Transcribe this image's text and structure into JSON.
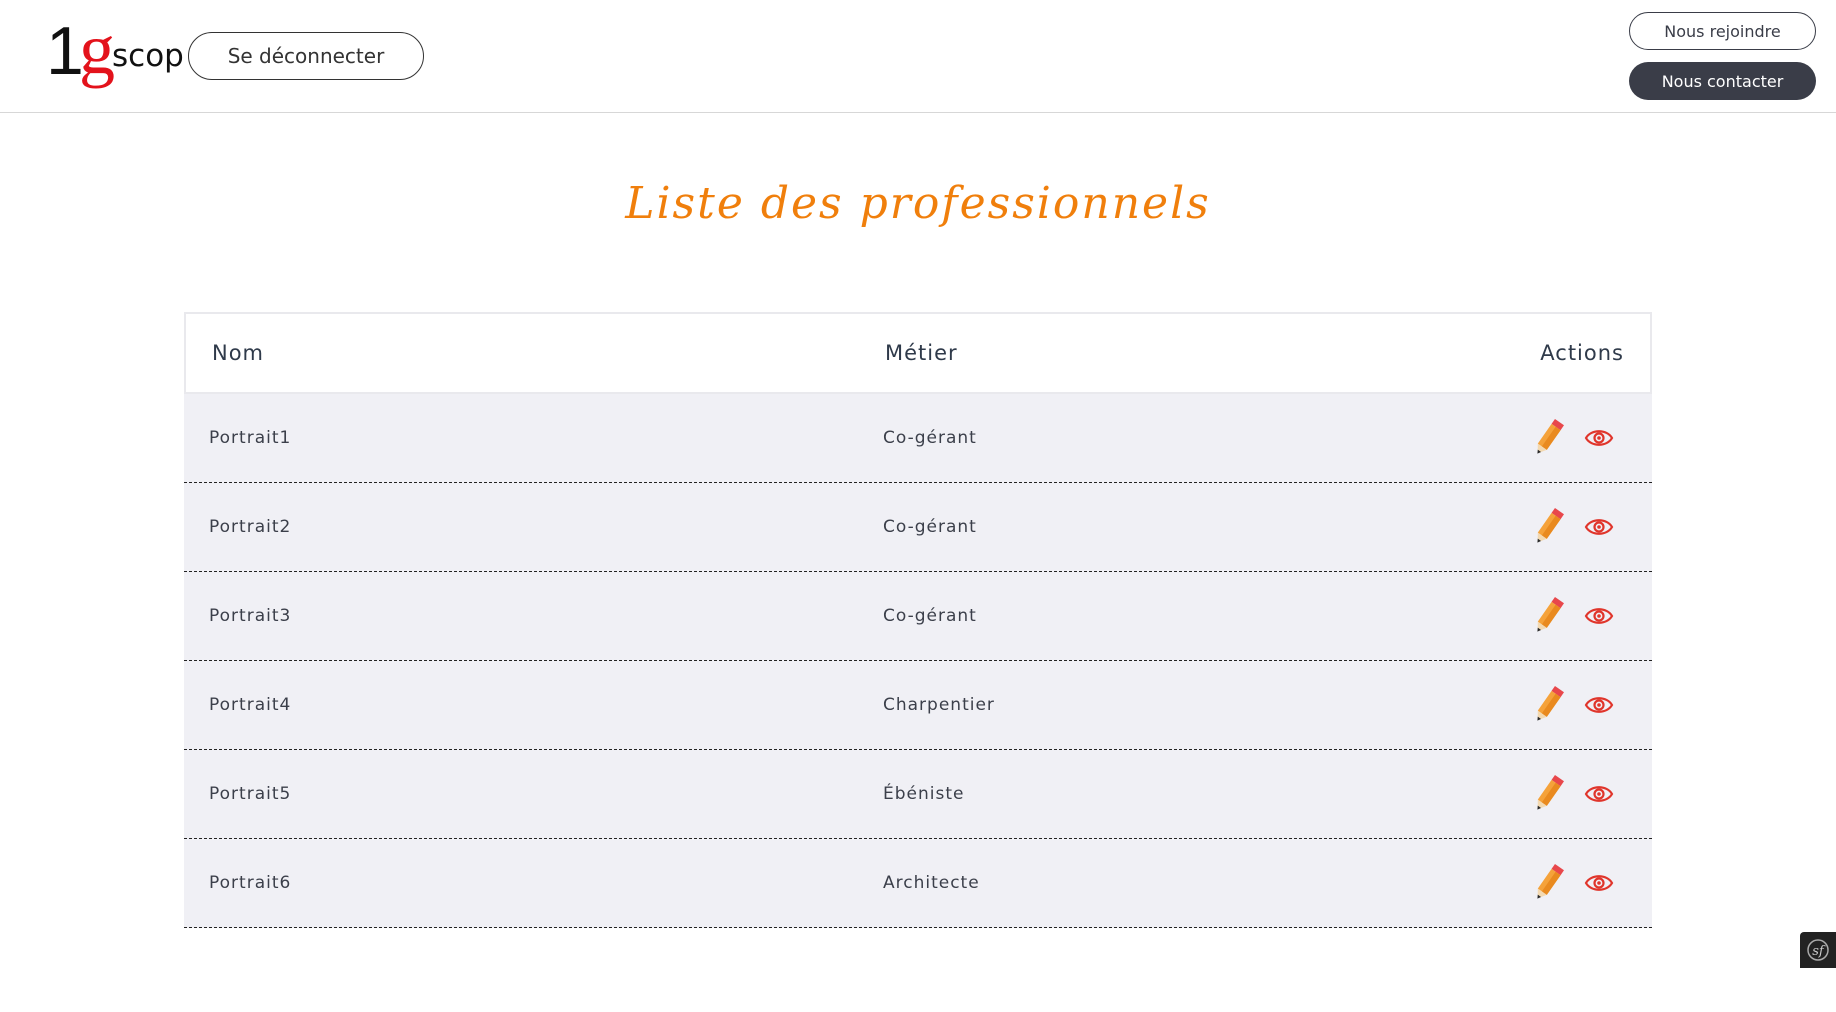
{
  "header": {
    "logo": {
      "digit": "1",
      "letter": "g",
      "word": "scop"
    },
    "logout_label": "Se déconnecter",
    "join_label": "Nous rejoindre",
    "contact_label": "Nous contacter"
  },
  "page": {
    "title": "Liste des professionnels"
  },
  "table": {
    "columns": [
      "Nom",
      "Métier",
      "Actions"
    ],
    "rows": [
      {
        "nom": "Portrait1",
        "metier": "Co-gérant"
      },
      {
        "nom": "Portrait2",
        "metier": "Co-gérant"
      },
      {
        "nom": "Portrait3",
        "metier": "Co-gérant"
      },
      {
        "nom": "Portrait4",
        "metier": "Charpentier"
      },
      {
        "nom": "Portrait5",
        "metier": "Ébéniste"
      },
      {
        "nom": "Portrait6",
        "metier": "Architecte"
      }
    ],
    "action_icons": [
      "pencil-icon",
      "eye-icon"
    ]
  },
  "colors": {
    "accent": "#f07f0c",
    "logo_red": "#e3121b",
    "dark_button": "#3a3d48",
    "row_bg": "#f0f0f5",
    "eye": "#e0352b"
  },
  "toolbar_icon": "symfony-icon"
}
